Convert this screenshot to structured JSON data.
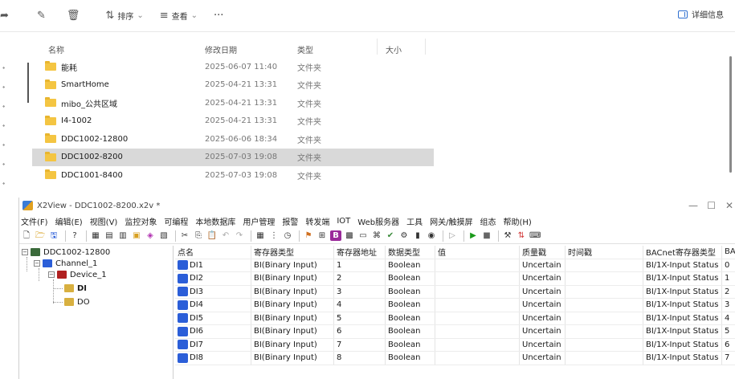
{
  "explorer": {
    "toolbar": {
      "sort_label": "排序",
      "view_label": "查看",
      "more_label": "···",
      "details_label": "详细信息"
    },
    "columns": {
      "name": "名称",
      "date": "修改日期",
      "type": "类型",
      "size": "大小"
    },
    "rows": [
      {
        "name": "能耗",
        "date": "2025-06-07 11:40",
        "type": "文件夹"
      },
      {
        "name": "SmartHome",
        "date": "2025-04-21 13:31",
        "type": "文件夹"
      },
      {
        "name": "mibo_公共区域",
        "date": "2025-04-21 13:31",
        "type": "文件夹"
      },
      {
        "name": "I4-1002",
        "date": "2025-04-21 13:31",
        "type": "文件夹"
      },
      {
        "name": "DDC1002-12800",
        "date": "2025-06-06 18:34",
        "type": "文件夹"
      },
      {
        "name": "DDC1002-8200",
        "date": "2025-07-03 19:08",
        "type": "文件夹",
        "selected": true
      },
      {
        "name": "DDC1001-8400",
        "date": "2025-07-03 19:08",
        "type": "文件夹"
      }
    ]
  },
  "x2view": {
    "title": "X2View - DDC1002-8200.x2v *",
    "menu": [
      "文件(F)",
      "编辑(E)",
      "视图(V)",
      "监控对象",
      "可编程",
      "本地数据库",
      "用户管理",
      "报警",
      "转发端",
      "IOT",
      "Web服务器",
      "工具",
      "网关/触摸屏",
      "组态",
      "帮助(H)"
    ],
    "tree": {
      "root": "DDC1002-12800",
      "channel": "Channel_1",
      "device": "Device_1",
      "di": "DI",
      "do": "DO"
    },
    "grid": {
      "headers": [
        "点名",
        "寄存器类型",
        "寄存器地址",
        "数据类型",
        "值",
        "质量戳",
        "时间戳",
        "BACnet寄存器类型",
        "BA"
      ],
      "rows": [
        [
          "DI1",
          "BI(Binary Input)",
          "1",
          "Boolean",
          "",
          "Uncertain",
          "",
          "BI/1X-Input Status",
          "0"
        ],
        [
          "DI2",
          "BI(Binary Input)",
          "2",
          "Boolean",
          "",
          "Uncertain",
          "",
          "BI/1X-Input Status",
          "1"
        ],
        [
          "DI3",
          "BI(Binary Input)",
          "3",
          "Boolean",
          "",
          "Uncertain",
          "",
          "BI/1X-Input Status",
          "2"
        ],
        [
          "DI4",
          "BI(Binary Input)",
          "4",
          "Boolean",
          "",
          "Uncertain",
          "",
          "BI/1X-Input Status",
          "3"
        ],
        [
          "DI5",
          "BI(Binary Input)",
          "5",
          "Boolean",
          "",
          "Uncertain",
          "",
          "BI/1X-Input Status",
          "4"
        ],
        [
          "DI6",
          "BI(Binary Input)",
          "6",
          "Boolean",
          "",
          "Uncertain",
          "",
          "BI/1X-Input Status",
          "5"
        ],
        [
          "DI7",
          "BI(Binary Input)",
          "7",
          "Boolean",
          "",
          "Uncertain",
          "",
          "BI/1X-Input Status",
          "6"
        ],
        [
          "DI8",
          "BI(Binary Input)",
          "8",
          "Boolean",
          "",
          "Uncertain",
          "",
          "BI/1X-Input Status",
          "7"
        ]
      ]
    }
  },
  "colors": {
    "folder": "#f4c542",
    "selection": "#d9d9d9",
    "point_icon": "#2b5ed8"
  }
}
